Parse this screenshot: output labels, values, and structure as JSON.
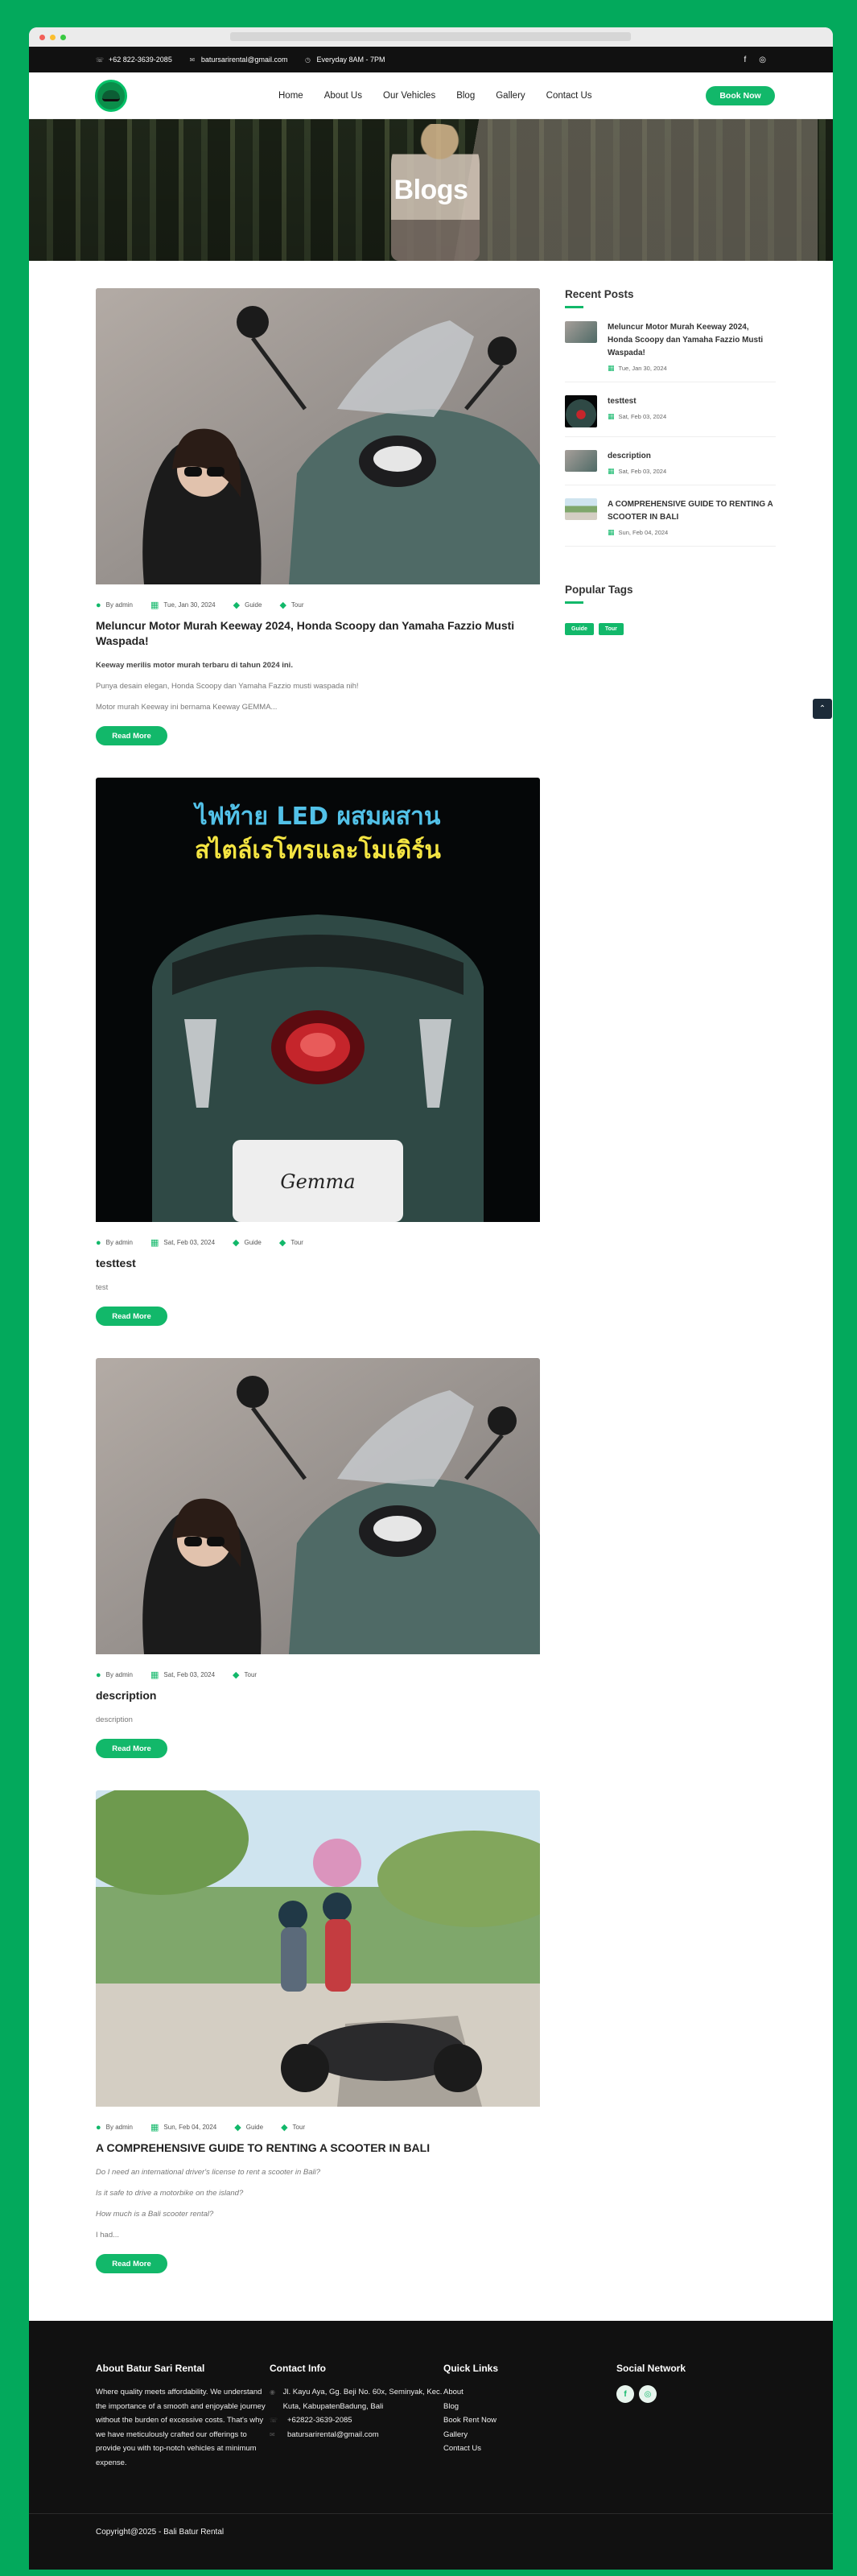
{
  "topbar": {
    "phone": "+62 822-3639-2085",
    "email": "batursarirental@gmail.com",
    "hours": "Everyday 8AM - 7PM"
  },
  "nav": {
    "items": [
      "Home",
      "About Us",
      "Our Vehicles",
      "Blog",
      "Gallery",
      "Contact Us"
    ],
    "cta": "Book Now"
  },
  "hero": {
    "title": "Blogs"
  },
  "posts": [
    {
      "author": "By admin",
      "date": "Tue, Jan 30, 2024",
      "tags": [
        "Guide",
        "Tour"
      ],
      "title": "Meluncur Motor Murah Keeway 2024, Honda Scoopy dan Yamaha Fazzio Musti Waspada!",
      "lines": [
        "Keeway merilis motor murah terbaru di tahun 2024 ini.",
        "Punya desain elegan, Honda Scoopy dan Yamaha Fazzio musti waspada nih!",
        "Motor murah Keeway ini bernama Keeway GEMMA..."
      ],
      "read_more": "Read More"
    },
    {
      "author": "By admin",
      "date": "Sat, Feb 03, 2024",
      "tags": [
        "Guide",
        "Tour"
      ],
      "title": "testtest",
      "lines": [
        "test"
      ],
      "image_text_1": "ไฟท้าย LED ผสมผสาน",
      "image_text_2": "สไตล์เรโทรและโมเดิร์น",
      "plate_text": "Gemma",
      "read_more": "Read More"
    },
    {
      "author": "By admin",
      "date": "Sat, Feb 03, 2024",
      "tags": [
        "Tour"
      ],
      "title": "description",
      "lines": [
        "description"
      ],
      "read_more": "Read More"
    },
    {
      "author": "By admin",
      "date": "Sun, Feb 04, 2024",
      "tags": [
        "Guide",
        "Tour"
      ],
      "title": "A COMPREHENSIVE GUIDE TO RENTING A SCOOTER IN BALI",
      "lines": [
        "Do I need an international driver's license to rent a scooter in Bali?",
        "Is it safe to drive a motorbike on the island?",
        "How much is a Bali scooter rental?",
        "I had..."
      ],
      "read_more": "Read More"
    }
  ],
  "sidebar": {
    "recent_title": "Recent Posts",
    "recent": [
      {
        "title": "Meluncur Motor Murah Keeway 2024, Honda Scoopy dan Yamaha Fazzio Musti Waspada!",
        "date": "Tue, Jan 30, 2024"
      },
      {
        "title": "testtest",
        "date": "Sat, Feb 03, 2024"
      },
      {
        "title": "description",
        "date": "Sat, Feb 03, 2024"
      },
      {
        "title": "A COMPREHENSIVE GUIDE TO RENTING A SCOOTER IN BALI",
        "date": "Sun, Feb 04, 2024"
      }
    ],
    "tags_title": "Popular Tags",
    "tags": [
      "Guide",
      "Tour"
    ]
  },
  "footer": {
    "about_title": "About Batur Sari Rental",
    "about_text": "Where quality meets affordability. We understand the importance of a smooth and enjoyable journey without the burden of excessive costs. That's why we have meticulously crafted our offerings to provide you with top-notch vehicles at minimum expense.",
    "contact_title": "Contact Info",
    "address": "Jl. Kayu Aya, Gg. Beji No. 60x, Seminyak, Kec. Kuta, KabupatenBadung, Bali",
    "phone": "+62822-3639-2085",
    "email": "batursarirental@gmail.com",
    "links_title": "Quick Links",
    "links": [
      "About",
      "Blog",
      "Book Rent Now",
      "Gallery",
      "Contact Us"
    ],
    "social_title": "Social Network",
    "copyright": "Copyright@2025 - Bali Batur Rental"
  },
  "colors": {
    "accent": "#12b86a",
    "frame": "#03a95c",
    "dark": "#111111"
  }
}
